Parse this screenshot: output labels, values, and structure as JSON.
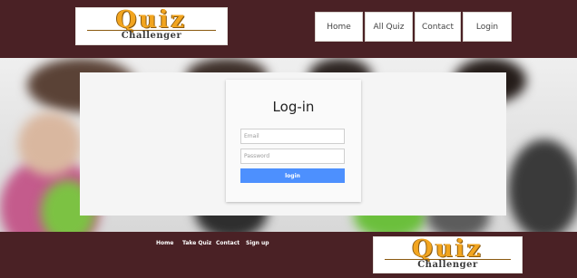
{
  "header": {
    "logo": {
      "word": "Quiz",
      "subtitle": "Challenger"
    },
    "nav": [
      {
        "label": "Home"
      },
      {
        "label": "All Quiz"
      },
      {
        "label": "Contact"
      },
      {
        "label": "Login"
      }
    ]
  },
  "login": {
    "title": "Log-in",
    "email_placeholder": "Email",
    "password_placeholder": "Password",
    "button_label": "login"
  },
  "footer": {
    "links": [
      {
        "label": "Home"
      },
      {
        "label": "Take Quiz"
      },
      {
        "label": "Contact"
      },
      {
        "label": "Sign up"
      }
    ],
    "logo": {
      "word": "Quiz",
      "subtitle": "Challenger"
    }
  },
  "colors": {
    "header_bg": "#4a2125",
    "button_accent": "#4d90fe",
    "logo_gold": "#f2a51f"
  }
}
